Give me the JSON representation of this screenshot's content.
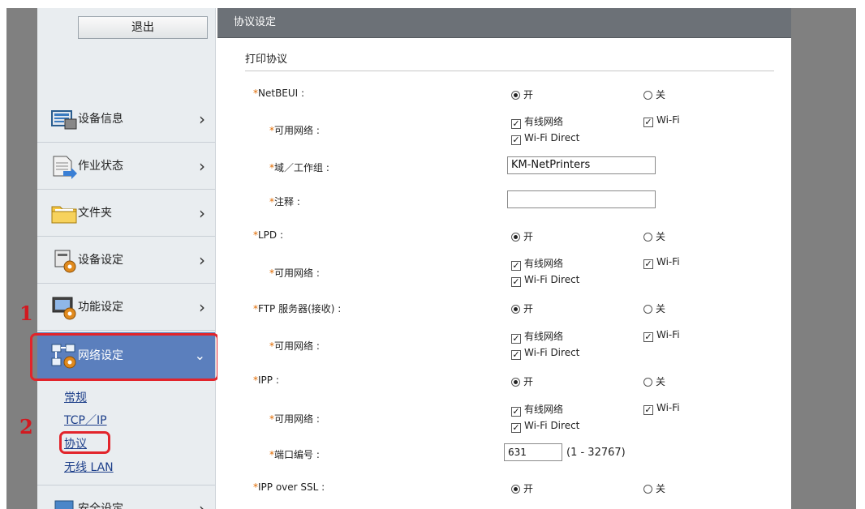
{
  "sidebar": {
    "logout": "退出",
    "items": [
      {
        "label": "设备信息",
        "icon": "device-info-icon"
      },
      {
        "label": "作业状态",
        "icon": "job-status-icon"
      },
      {
        "label": "文件夹",
        "icon": "folder-icon"
      },
      {
        "label": "设备设定",
        "icon": "device-settings-icon"
      },
      {
        "label": "功能设定",
        "icon": "function-settings-icon"
      },
      {
        "label": "网络设定",
        "icon": "network-settings-icon"
      },
      {
        "label": "安全设定",
        "icon": "security-settings-icon"
      }
    ],
    "submenu": [
      "常规",
      "TCP／IP",
      "协议",
      "无线 LAN"
    ]
  },
  "annotations": {
    "step1": "1",
    "step2": "2"
  },
  "content": {
    "header": "协议设定",
    "section": "打印协议",
    "on": "开",
    "off": "关",
    "wired": "有线网络",
    "wifi": "Wi-Fi",
    "wifi_direct": "Wi-Fi Direct",
    "rows": {
      "netbeui": "NetBEUI :",
      "avail_network": "可用网络 :",
      "workgroup": "域／工作组 :",
      "comment": "注释 :",
      "lpd": "LPD :",
      "ftp": "FTP 服务器(接收) :",
      "ipp": "IPP :",
      "port": "端口编号 :",
      "ipp_ssl": "IPP over SSL :"
    },
    "workgroup_value": "KM-NetPrinters",
    "comment_value": "",
    "port_value": "631",
    "port_range": "(1 - 32767)"
  },
  "colors": {
    "accent": "#5b7fbd",
    "highlight": "#e2242b",
    "header": "#6c7177"
  }
}
